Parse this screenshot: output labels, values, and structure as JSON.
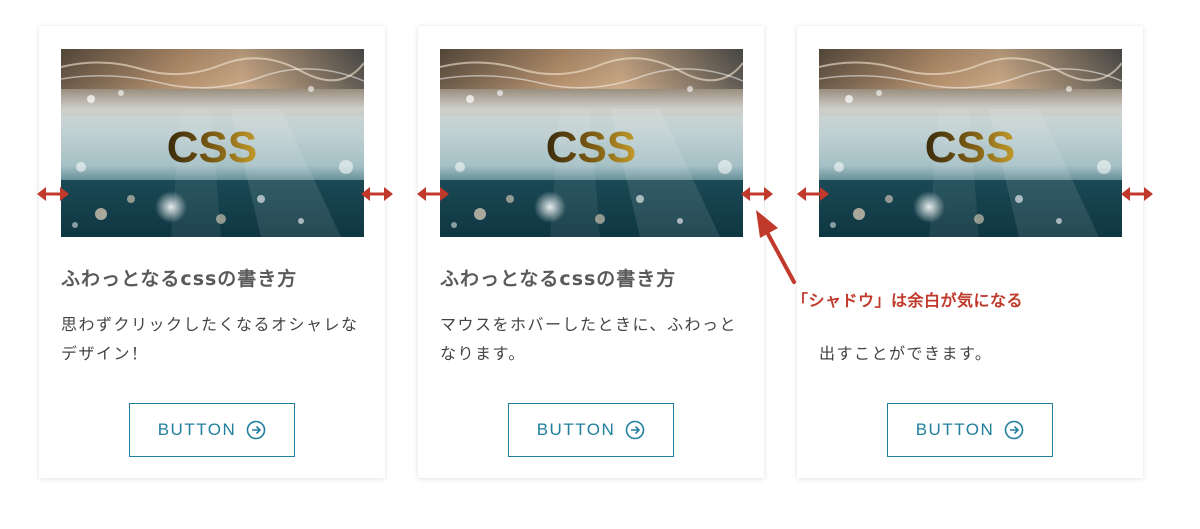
{
  "colors": {
    "accent": "#227f9e",
    "annotation": "#c0392b",
    "title": "#5a5a5a",
    "text": "#444444"
  },
  "cards": [
    {
      "image_label": "CSS",
      "title": "ふわっとなるcssの書き方",
      "description": "思わずクリックしたくなるオシャレなデザイン！",
      "button_label": "BUTTON"
    },
    {
      "image_label": "CSS",
      "title": "ふわっとなるcssの書き方",
      "description": "マウスをホバーしたときに、ふわっとなります。",
      "button_label": "BUTTON"
    },
    {
      "image_label": "CSS",
      "title": "",
      "description": "出すことができます。",
      "button_label": "BUTTON"
    }
  ],
  "annotation": {
    "callout": "「シャドウ」は余白が気になる",
    "marker_icon": "double-arrow-icon",
    "pointer_icon": "pointer-arrow-icon"
  },
  "icons": {
    "button_icon": "circle-arrow-right-icon"
  }
}
